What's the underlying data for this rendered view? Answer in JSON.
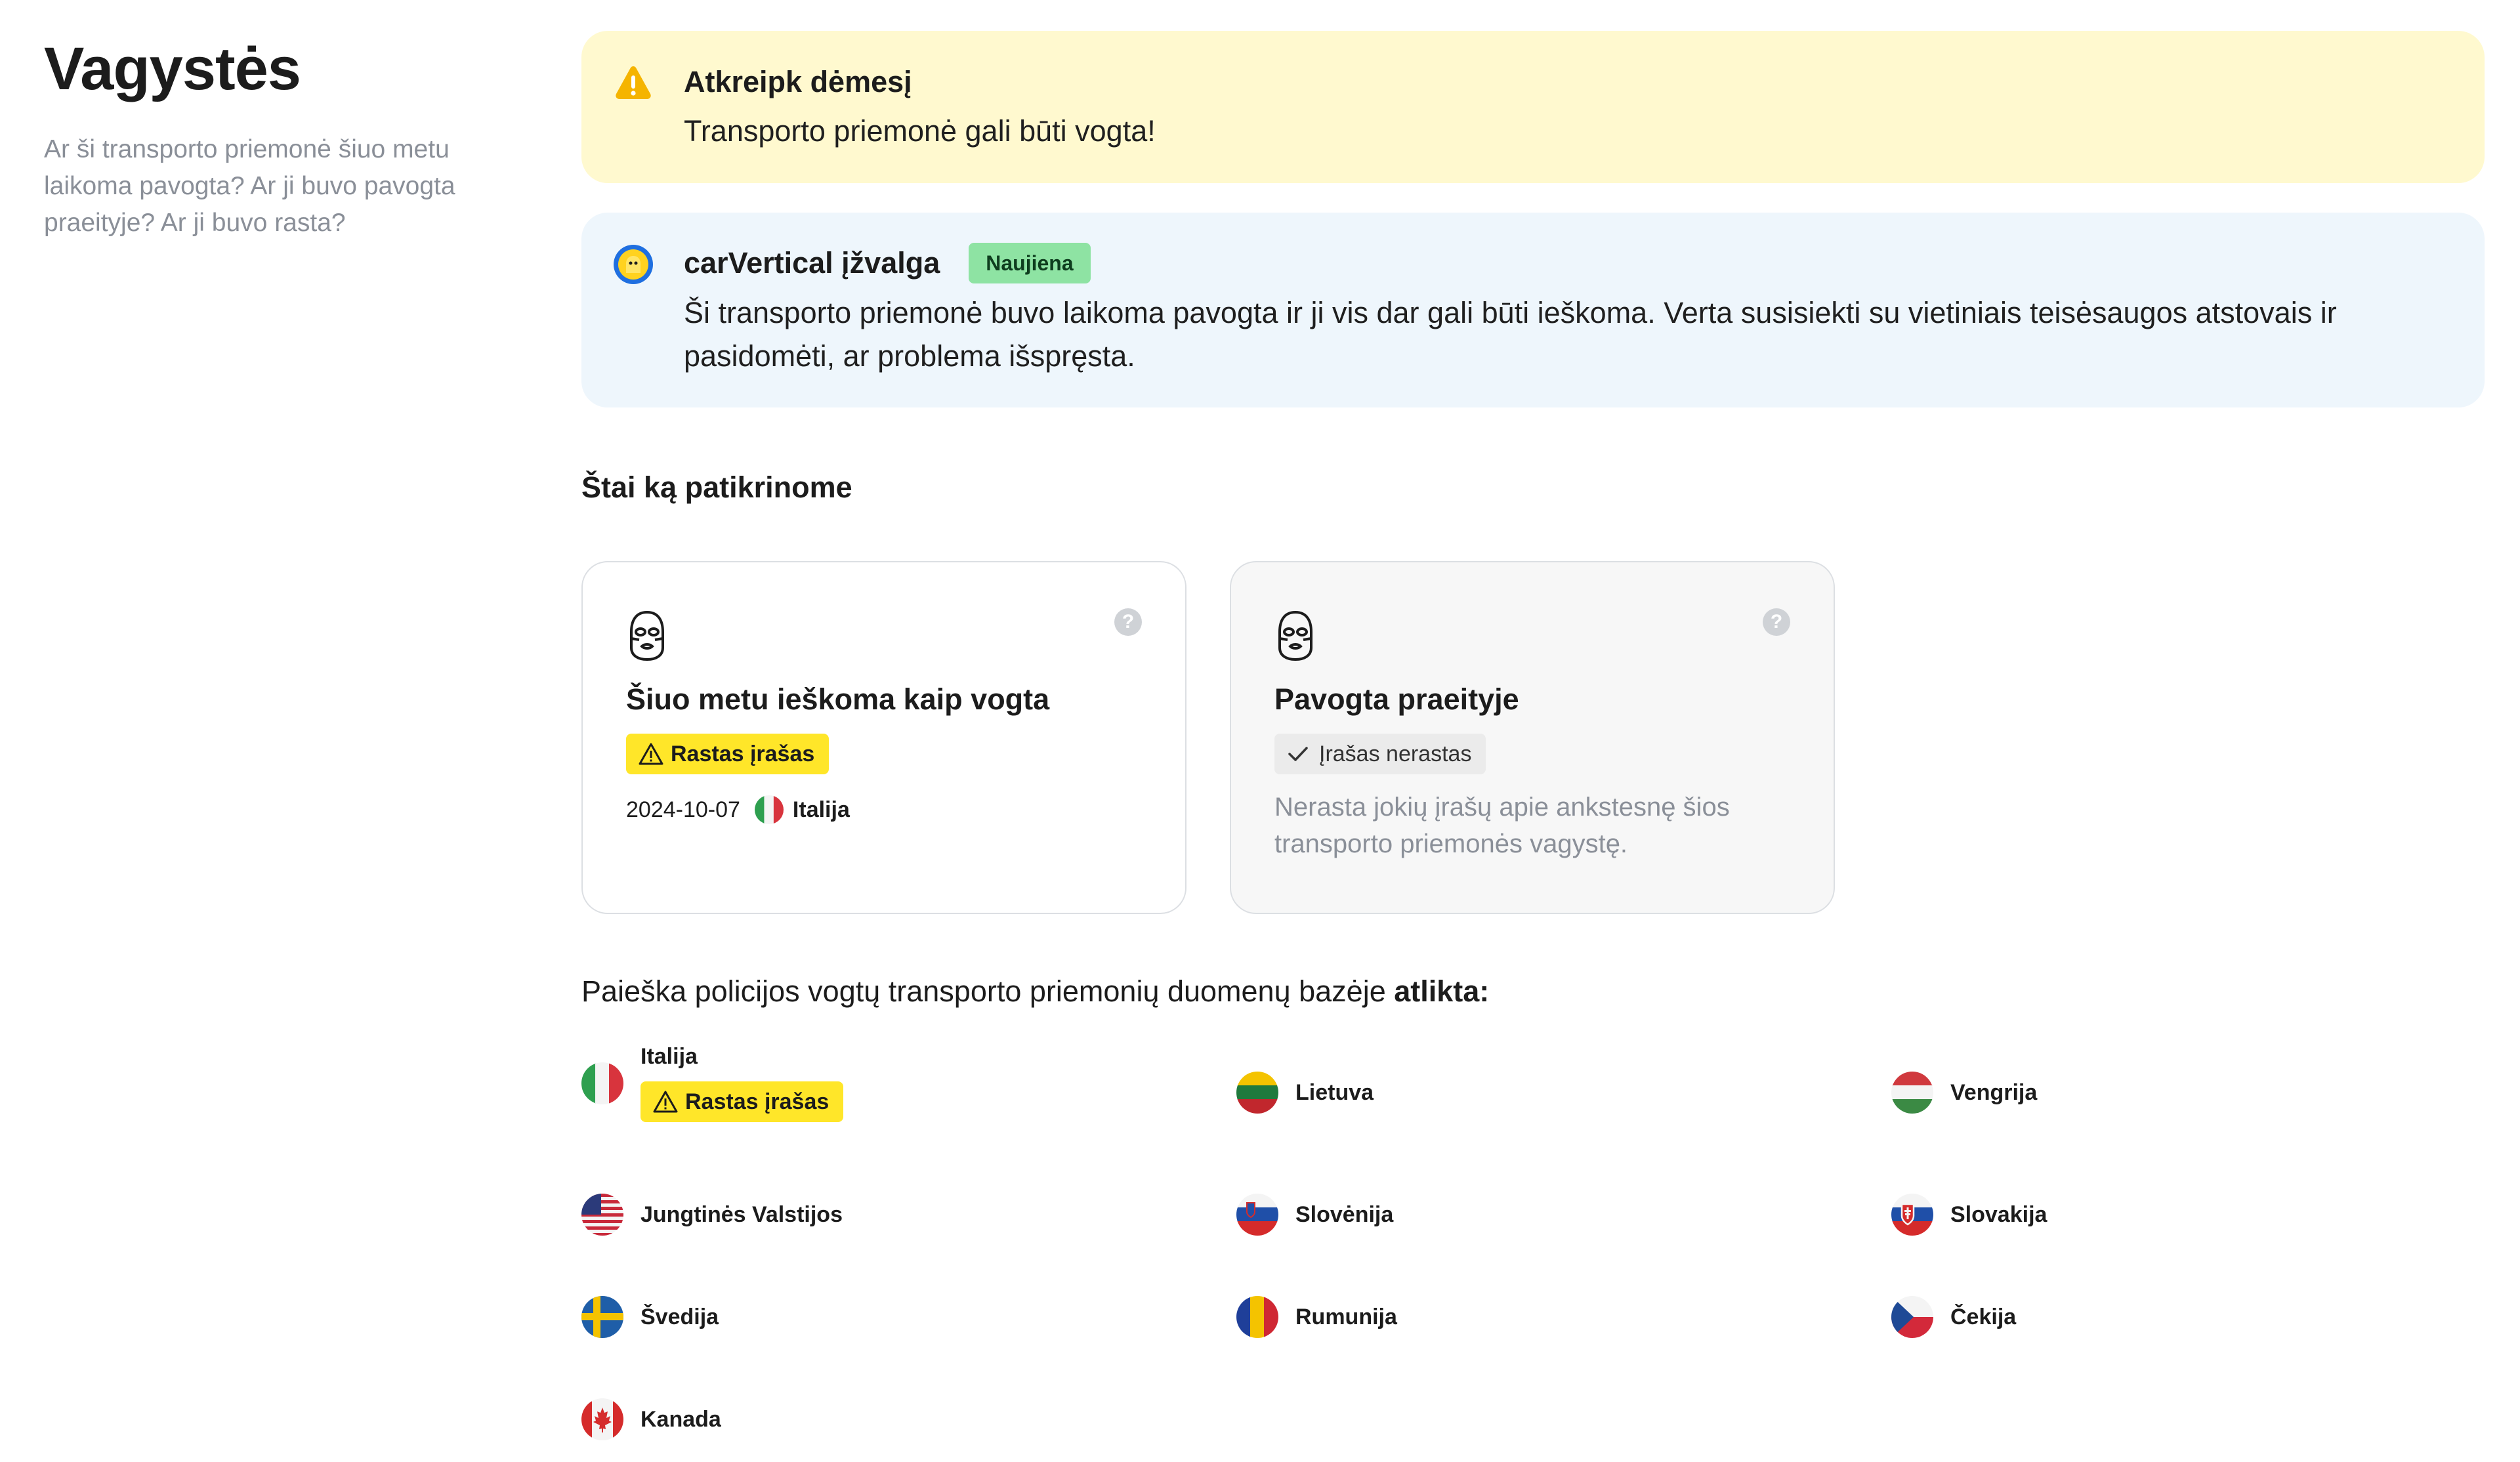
{
  "sidebar": {
    "title": "Vagystės",
    "description": "Ar ši transporto priemonė šiuo metu laikoma pavogta? Ar ji buvo pavogta praeityje? Ar ji buvo rasta?"
  },
  "warning_alert": {
    "title": "Atkreipk dėmesį",
    "text": "Transporto priemonė gali būti vogta!"
  },
  "insight_alert": {
    "title": "carVertical įžvalga",
    "badge": "Naujiena",
    "text": "Ši transporto priemonė buvo laikoma pavogta ir ji vis dar gali būti ieškoma. Verta susisiekti su vietiniais teisėsaugos atstovais ir pasidomėti, ar problema išspręsta."
  },
  "checked_title": "Štai ką patikrinome",
  "cards": [
    {
      "title": "Šiuo metu ieškoma kaip vogta",
      "status": "Rastas įrašas",
      "date": "2024-10-07",
      "country": "Italija",
      "help": "?"
    },
    {
      "title": "Pavogta praeityje",
      "status": "Įrašas nerastas",
      "description": "Nerasta jokių įrašų apie ankstesnę šios transporto priemonės vagystę.",
      "help": "?"
    }
  ],
  "database": {
    "text": "Paieška policijos vogtų transporto priemonių duomenų bazėje ",
    "bold": "atlikta:"
  },
  "countries": [
    {
      "name": "Italija",
      "status": "Rastas įrašas",
      "flag": "italy-flag-icon"
    },
    {
      "name": "Lietuva",
      "flag": "lithuania-flag-icon"
    },
    {
      "name": "Vengrija",
      "flag": "hungary-flag-icon"
    },
    {
      "name": "Jungtinės Valstijos",
      "flag": "usa-flag-icon"
    },
    {
      "name": "Slovėnija",
      "flag": "slovenia-flag-icon"
    },
    {
      "name": "Slovakija",
      "flag": "slovakia-flag-icon"
    },
    {
      "name": "Švedija",
      "flag": "sweden-flag-icon"
    },
    {
      "name": "Rumunija",
      "flag": "romania-flag-icon"
    },
    {
      "name": "Čekija",
      "flag": "czechia-flag-icon"
    },
    {
      "name": "Kanada",
      "flag": "canada-flag-icon"
    }
  ],
  "colors": {
    "warning_bg": "#fff9cf",
    "info_bg": "#eef6fc",
    "found_yellow": "#ffe629",
    "badge_green": "#8ee3a3",
    "warning_icon": "#f5b400"
  }
}
